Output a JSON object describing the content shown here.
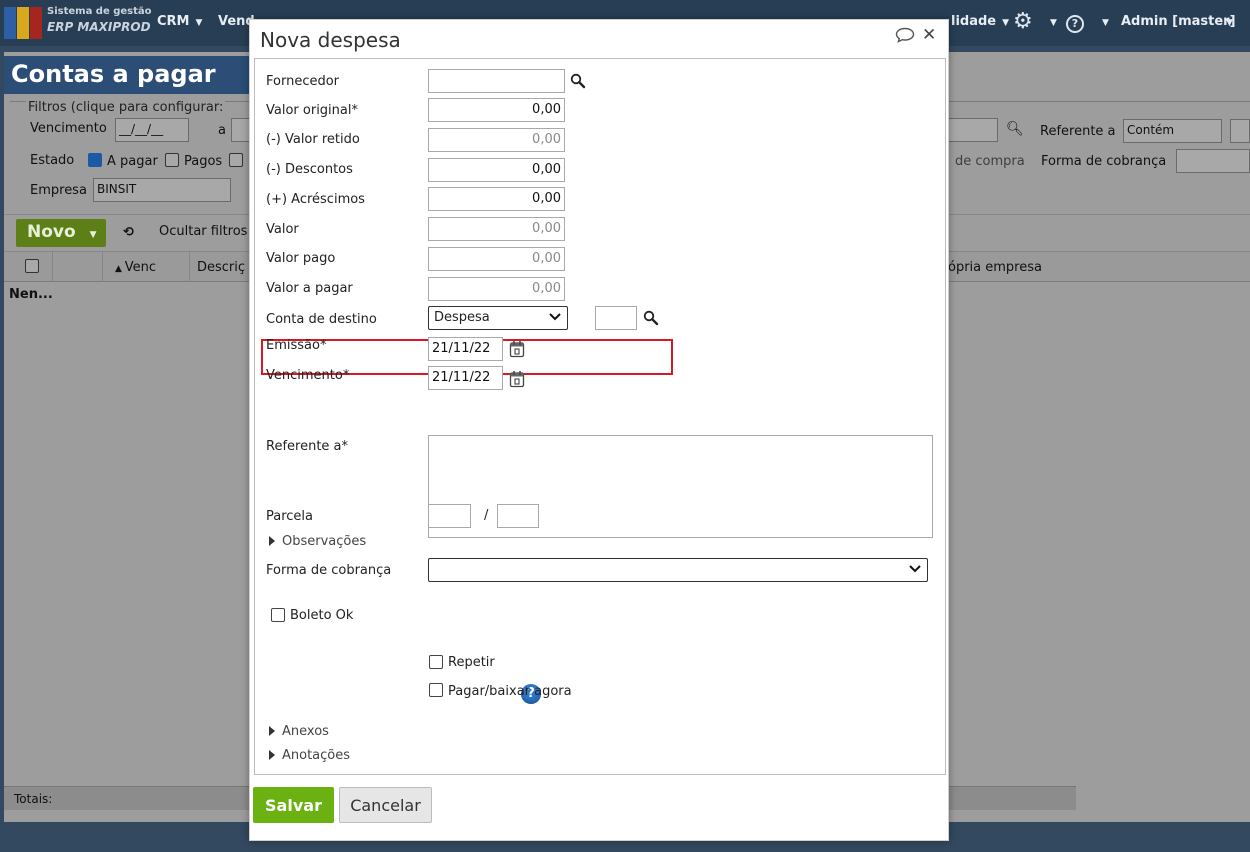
{
  "app": {
    "brand_line1": "Sistema de gestão",
    "brand_line2": "ERP MAXIPROD",
    "nav": [
      "CRM",
      "Vend",
      "lidade"
    ],
    "user": "Admin [master]"
  },
  "page": {
    "title": "Contas a pagar",
    "filters_label": "Filtros (clique para configurar:",
    "vencimento_label": "Vencimento",
    "vencimento_from": "__/__/__",
    "vencimento_sep": "a",
    "estado_label": "Estado",
    "estado_a_pagar": "A pagar",
    "estado_pagos": "Pagos",
    "empresa_label": "Empresa",
    "empresa_value": "BINSIT",
    "referente_label": "Referente a",
    "referente_mode": "Contém",
    "de_compra_text": "de compra",
    "forma_cobranca_label": "Forma de cobrança",
    "novo_label": "Novo",
    "ocultar_filtros": "Ocultar filtros",
    "col_venc": "Venc",
    "col_descr": "Descriç",
    "col_propria": "ópria empresa",
    "empty_row": "Nen...",
    "totais": "Totais:"
  },
  "modal": {
    "title": "Nova despesa",
    "fields": {
      "fornecedor": {
        "label": "Fornecedor",
        "value": ""
      },
      "valor_original": {
        "label": "Valor original*",
        "value": "0,00"
      },
      "valor_retido": {
        "label": "(-) Valor retido",
        "value": "0,00"
      },
      "descontos": {
        "label": "(-) Descontos",
        "value": "0,00"
      },
      "acrescimos": {
        "label": "(+) Acréscimos",
        "value": "0,00"
      },
      "valor": {
        "label": "Valor",
        "value": "0,00"
      },
      "valor_pago": {
        "label": "Valor pago",
        "value": "0,00"
      },
      "valor_a_pagar": {
        "label": "Valor a pagar",
        "value": "0,00"
      },
      "conta_destino": {
        "label": "Conta de destino",
        "value": "Despesa",
        "code": ""
      },
      "emissao": {
        "label": "Emissão*",
        "value": "21/11/22"
      },
      "vencimento": {
        "label": "Vencimento*",
        "value": "21/11/22"
      },
      "referente": {
        "label": "Referente a*",
        "value": ""
      },
      "parcela": {
        "label": "Parcela",
        "sep": "/"
      },
      "forma_cobranca": {
        "label": "Forma de cobrança",
        "value": ""
      }
    },
    "observacoes": "Observações",
    "boleto_ok": "Boleto Ok",
    "repetir": "Repetir",
    "pagar_agora": "Pagar/baixar agora",
    "anexos": "Anexos",
    "anotacoes": "Anotações",
    "save": "Salvar",
    "cancel": "Cancelar"
  },
  "colors": {
    "highlight": "#d51a25",
    "save_button": "#6bb111",
    "overlay": "#9d9d9d"
  }
}
